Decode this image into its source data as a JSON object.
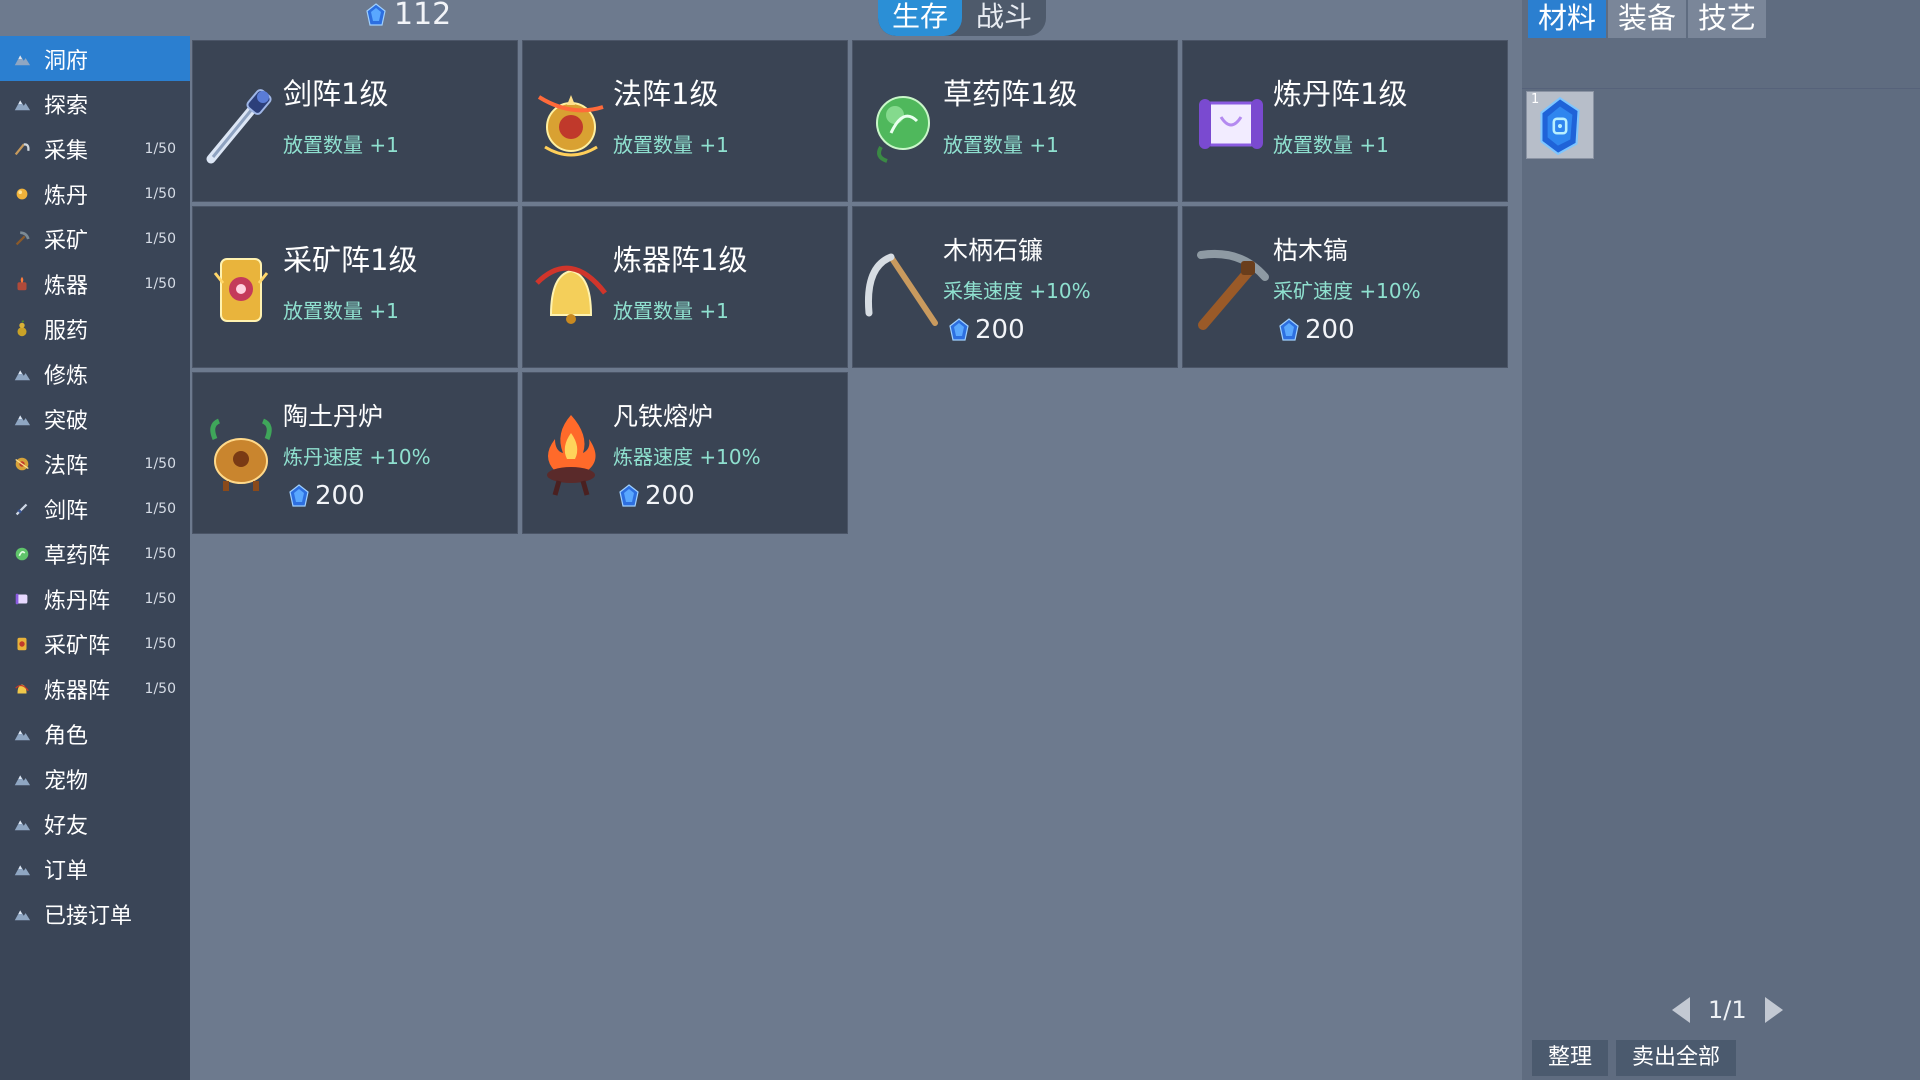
{
  "top": {
    "currency_icon": "blue-spirit-stone-icon",
    "currency_value": "112",
    "mode_tabs": [
      {
        "label": "生存",
        "active": true
      },
      {
        "label": "战斗",
        "active": false
      }
    ]
  },
  "sidebar": {
    "items": [
      {
        "label": "洞府",
        "count": "",
        "icon": "mountain-icon",
        "active": true
      },
      {
        "label": "探索",
        "count": "",
        "icon": "mountain-icon"
      },
      {
        "label": "采集",
        "count": "1/50",
        "icon": "sickle-icon"
      },
      {
        "label": "炼丹",
        "count": "1/50",
        "icon": "pill-icon"
      },
      {
        "label": "采矿",
        "count": "1/50",
        "icon": "pickaxe-icon"
      },
      {
        "label": "炼器",
        "count": "1/50",
        "icon": "furnace-icon"
      },
      {
        "label": "服药",
        "count": "",
        "icon": "gourd-icon"
      },
      {
        "label": "修炼",
        "count": "",
        "icon": "mountain-icon"
      },
      {
        "label": "突破",
        "count": "",
        "icon": "mountain-icon"
      },
      {
        "label": "法阵",
        "count": "1/50",
        "icon": "magic-array-icon"
      },
      {
        "label": "剑阵",
        "count": "1/50",
        "icon": "sword-icon"
      },
      {
        "label": "草药阵",
        "count": "1/50",
        "icon": "herb-orb-icon"
      },
      {
        "label": "炼丹阵",
        "count": "1/50",
        "icon": "scroll-icon"
      },
      {
        "label": "采矿阵",
        "count": "1/50",
        "icon": "talisman-icon"
      },
      {
        "label": "炼器阵",
        "count": "1/50",
        "icon": "bell-icon"
      },
      {
        "label": "角色",
        "count": "",
        "icon": "mountain-icon"
      },
      {
        "label": "宠物",
        "count": "",
        "icon": "mountain-icon"
      },
      {
        "label": "好友",
        "count": "",
        "icon": "mountain-icon"
      },
      {
        "label": "订单",
        "count": "",
        "icon": "mountain-icon"
      },
      {
        "label": "已接订单",
        "count": "",
        "icon": "mountain-icon"
      }
    ]
  },
  "cards": [
    {
      "title": "剑阵1级",
      "effect": "放置数量 +1",
      "price": "",
      "icon": "sword-icon"
    },
    {
      "title": "法阵1级",
      "effect": "放置数量 +1",
      "price": "",
      "icon": "magic-array-icon"
    },
    {
      "title": "草药阵1级",
      "effect": "放置数量 +1",
      "price": "",
      "icon": "herb-orb-icon"
    },
    {
      "title": "炼丹阵1级",
      "effect": "放置数量 +1",
      "price": "",
      "icon": "scroll-icon"
    },
    {
      "title": "采矿阵1级",
      "effect": "放置数量 +1",
      "price": "",
      "icon": "talisman-icon"
    },
    {
      "title": "炼器阵1级",
      "effect": "放置数量 +1",
      "price": "",
      "icon": "bell-icon"
    },
    {
      "title": "木柄石镰",
      "effect": "采集速度 +10%",
      "price": "200",
      "icon": "sickle-icon"
    },
    {
      "title": "枯木镐",
      "effect": "采矿速度 +10%",
      "price": "200",
      "icon": "pickaxe-icon"
    },
    {
      "title": "陶土丹炉",
      "effect": "炼丹速度 +10%",
      "price": "200",
      "icon": "cauldron-icon"
    },
    {
      "title": "凡铁熔炉",
      "effect": "炼器速度 +10%",
      "price": "200",
      "icon": "fire-furnace-icon"
    }
  ],
  "inventory": {
    "tabs": [
      {
        "label": "材料",
        "active": true
      },
      {
        "label": "装备",
        "active": false
      },
      {
        "label": "技艺",
        "active": false
      }
    ],
    "slots": [
      {
        "qty": "1",
        "icon": "blue-spirit-stone-icon"
      }
    ],
    "page": "1/1",
    "buttons": {
      "sort": "整理",
      "sell_all": "卖出全部"
    }
  },
  "colors": {
    "accent": "#2b7fd0",
    "effect_text": "#8fe0cf",
    "panel": "#3a4454",
    "background": "#6d7a8e"
  }
}
